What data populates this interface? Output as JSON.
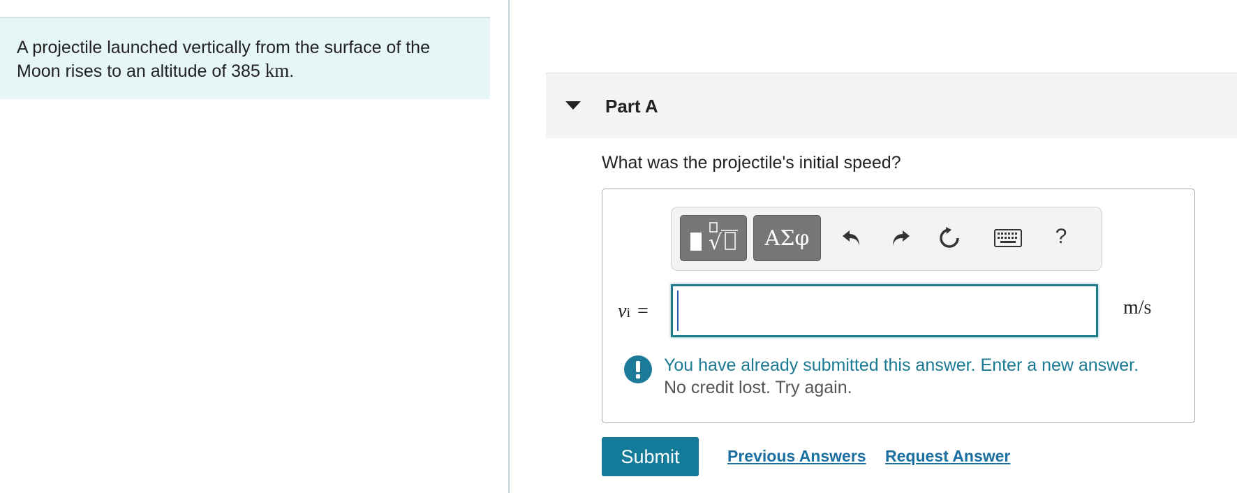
{
  "problem": {
    "text": "A projectile launched vertically from the surface of the Moon rises to an altitude of 385",
    "unit": "km",
    "end": "."
  },
  "part": {
    "title": "Part A",
    "question": "What was the projectile's initial speed?"
  },
  "toolbar": {
    "greek_label": "ΑΣφ",
    "help_label": "?",
    "icons": [
      "templates-icon",
      "undo-icon",
      "redo-icon",
      "reset-icon",
      "keyboard-icon",
      "help-icon"
    ]
  },
  "answer": {
    "variable": "v",
    "subscript": "i",
    "equals": "=",
    "value": "",
    "unit": "m/s"
  },
  "feedback": {
    "line1": "You have already submitted this answer. Enter a new answer.",
    "line2": "No credit lost. Try again."
  },
  "actions": {
    "submit": "Submit",
    "previous": "Previous Answers",
    "request": "Request Answer"
  },
  "colors": {
    "problem_bg": "#e6f6f6",
    "accent": "#147a99",
    "feedback_text": "#1a7a94",
    "link": "#1a6fa0"
  }
}
